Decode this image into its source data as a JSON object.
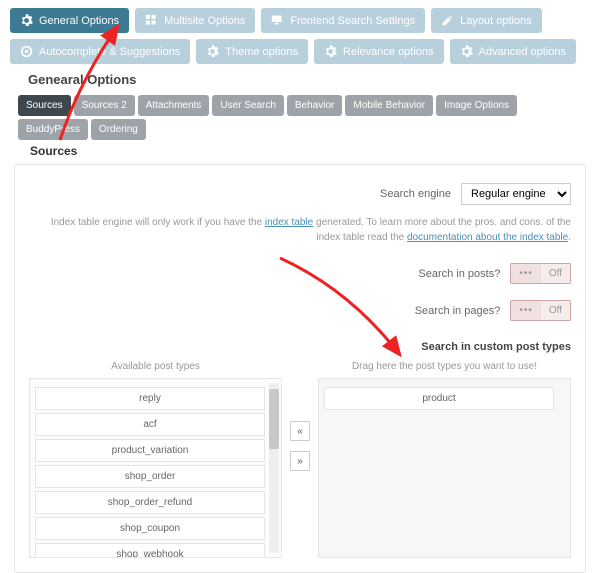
{
  "topTabs": [
    {
      "label": "General Options",
      "icon": "gear",
      "active": true
    },
    {
      "label": "Multisite Options",
      "icon": "grid",
      "active": false
    },
    {
      "label": "Frontend Search Settings",
      "icon": "screen",
      "active": false
    },
    {
      "label": "Layout options",
      "icon": "pencil",
      "active": false
    },
    {
      "label": "Autocomplete & Suggestions",
      "icon": "target",
      "active": false
    },
    {
      "label": "Theme options",
      "icon": "gear",
      "active": false
    },
    {
      "label": "Relevance options",
      "icon": "gear",
      "active": false
    },
    {
      "label": "Advanced options",
      "icon": "gear",
      "active": false
    }
  ],
  "sectionTitle": "Genearal Options",
  "subTabs": [
    {
      "label": "Sources",
      "active": true
    },
    {
      "label": "Sources 2"
    },
    {
      "label": "Attachments"
    },
    {
      "label": "User Search"
    },
    {
      "label": "Behavior"
    },
    {
      "label": "Mobile Behavior"
    },
    {
      "label": "Image Options"
    },
    {
      "label": "BuddyPress"
    },
    {
      "label": "Ordering"
    }
  ],
  "subSection": "Sources",
  "searchEngine": {
    "label": "Search engine",
    "value": "Regular engine"
  },
  "note": {
    "pre": "Index table engine will only work if you have the ",
    "link1": "index table",
    "mid": " generated. To learn more about the pros. and cons. of the index table read the ",
    "link2": "documentation about the index table",
    "post": "."
  },
  "toggles": {
    "posts": {
      "label": "Search in posts?",
      "off": "Off"
    },
    "pages": {
      "label": "Search in pages?",
      "off": "Off"
    }
  },
  "cptHeading": "Search in custom post types",
  "available": {
    "title": "Available post types",
    "items": [
      "reply",
      "acf",
      "product_variation",
      "shop_order",
      "shop_order_refund",
      "shop_coupon",
      "shop_webhook"
    ]
  },
  "selected": {
    "title": "Drag here the post types you want to use!",
    "items": [
      "product"
    ]
  },
  "moveLeft": "«",
  "moveRight": "»"
}
